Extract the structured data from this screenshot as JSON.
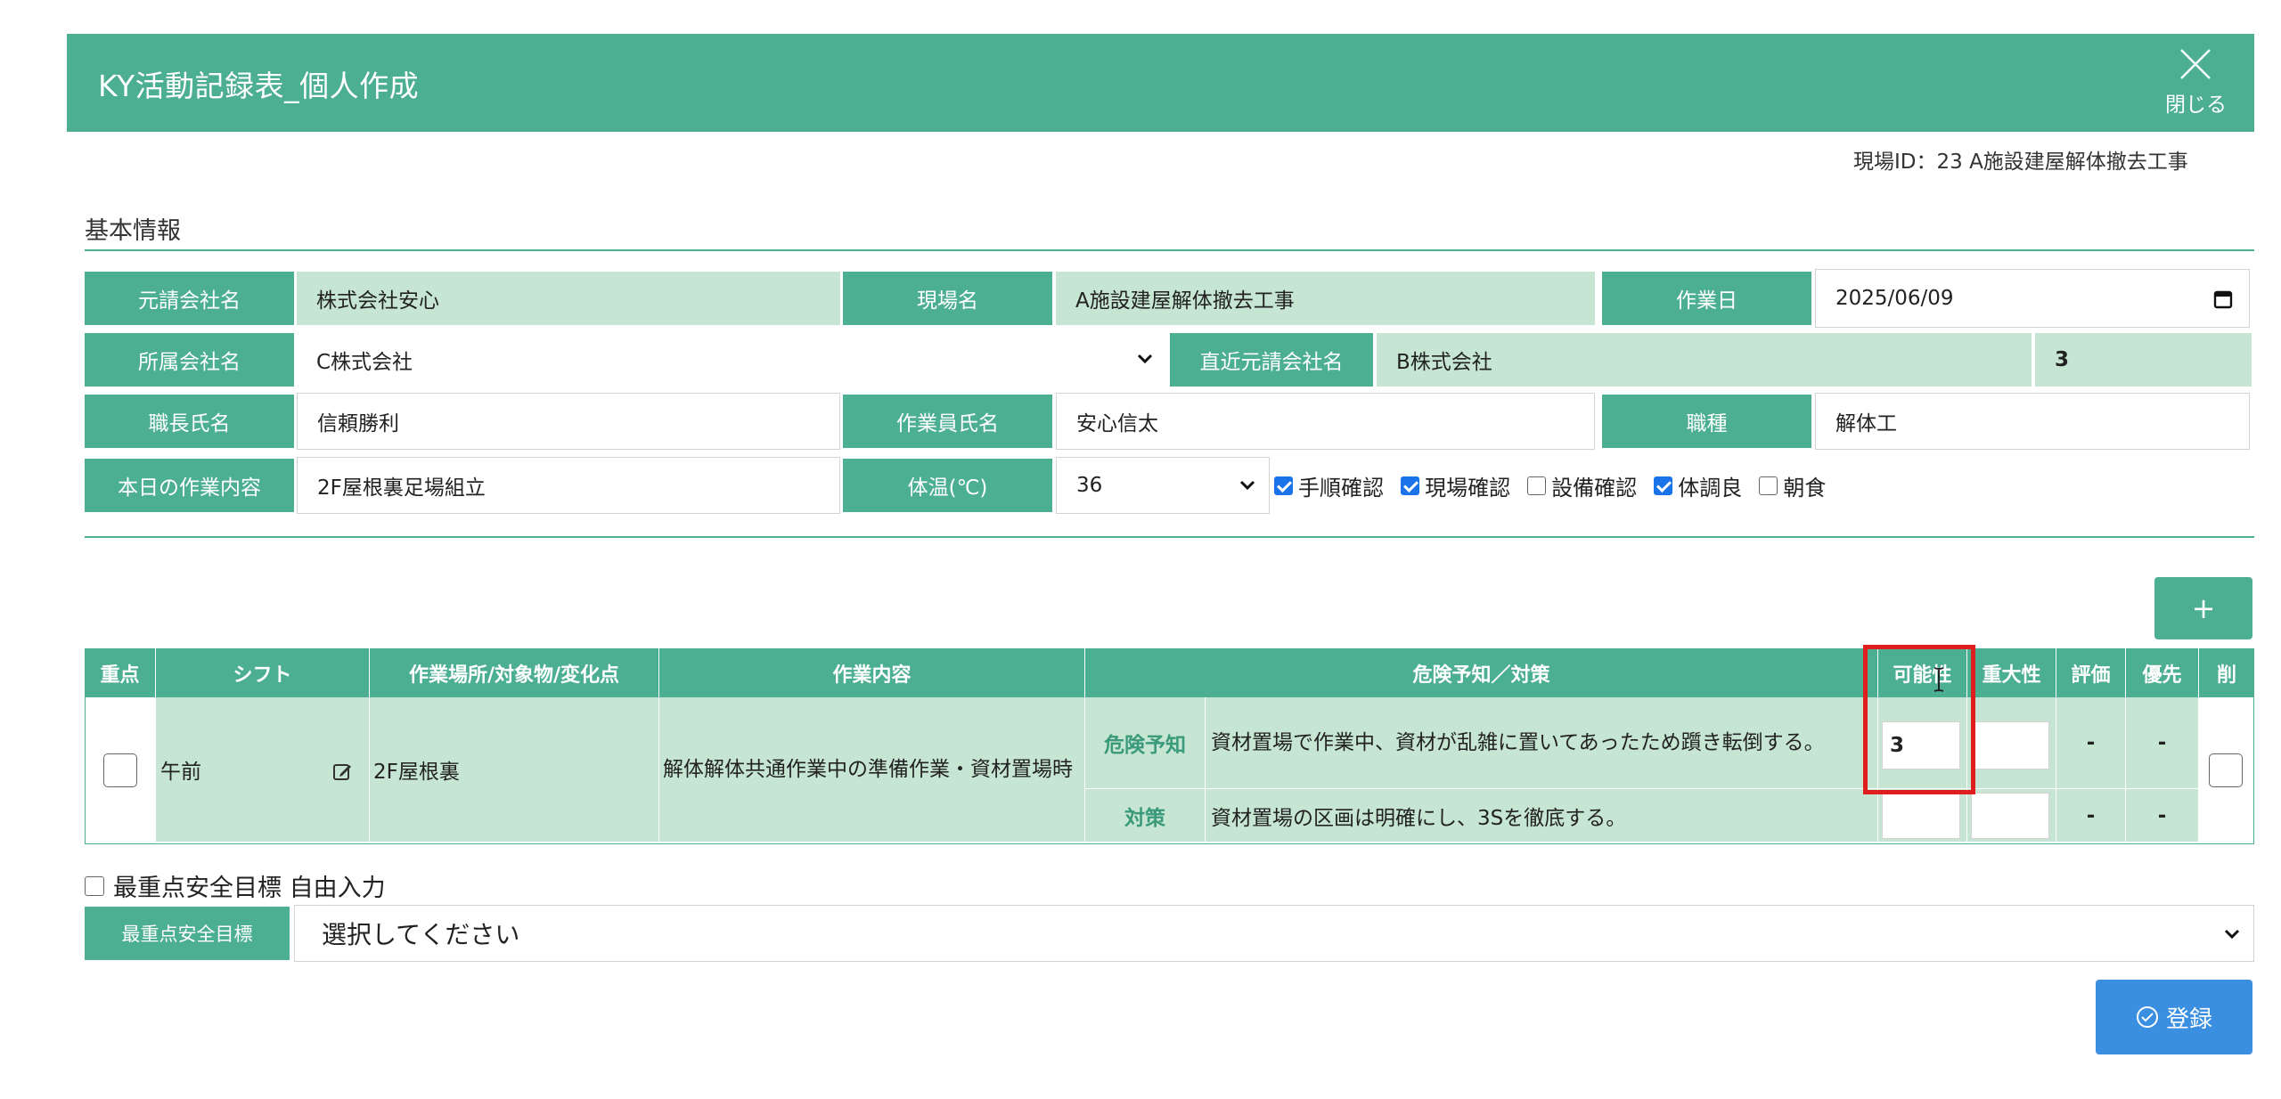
{
  "header": {
    "title": "KY活動記録表_個人作成",
    "close_label": "閉じる"
  },
  "site_id": "現場ID：23 A施設建屋解体撤去工事",
  "section": {
    "title": "基本情報"
  },
  "form": {
    "prime_company_label": "元請会社名",
    "prime_company_value": "株式会社安心",
    "site_name_label": "現場名",
    "site_name_value": "A施設建屋解体撤去工事",
    "work_date_label": "作業日",
    "work_date_value": "2025/06/09",
    "affiliation_label": "所属会社名",
    "affiliation_value": "C株式会社",
    "direct_prime_label": "直近元請会社名",
    "direct_prime_value": "B株式会社",
    "direct_prime_number": "3",
    "foreman_label": "職長氏名",
    "foreman_value": "信頼勝利",
    "worker_label": "作業員氏名",
    "worker_value": "安心信太",
    "job_type_label": "職種",
    "job_type_value": "解体工",
    "todays_work_label": "本日の作業内容",
    "todays_work_value": "2F屋根裏足場組立",
    "temp_label": "体温(℃)",
    "temp_value": "36",
    "checks": [
      {
        "label": "手順確認",
        "checked": true
      },
      {
        "label": "現場確認",
        "checked": true
      },
      {
        "label": "設備確認",
        "checked": false
      },
      {
        "label": "体調良",
        "checked": true
      },
      {
        "label": "朝食",
        "checked": false
      }
    ]
  },
  "add_button_label": "+",
  "table": {
    "headers": {
      "priority": "重点",
      "shift": "シフト",
      "location": "作業場所/対象物/変化点",
      "work": "作業内容",
      "hazard": "危険予知／対策",
      "possibility": "可能性",
      "severity": "重大性",
      "evaluation": "評価",
      "precedence": "優先",
      "delete": "削"
    },
    "row": {
      "shift": "午前",
      "location": "2F屋根裏",
      "work": "解体解体共通作業中の準備作業・資材置場時",
      "hazard_label": "危険予知",
      "hazard_text": "資材置場で作業中、資材が乱雑に置いてあったため躓き転倒する。",
      "measure_label": "対策",
      "measure_text": "資材置場の区画は明確にし、3Sを徹底する。",
      "possibility_value": "3",
      "dash": "-"
    }
  },
  "goal": {
    "free_input_label": "最重点安全目標 自由入力",
    "label": "最重点安全目標",
    "select_value": "選択してください"
  },
  "register_label": "登録"
}
